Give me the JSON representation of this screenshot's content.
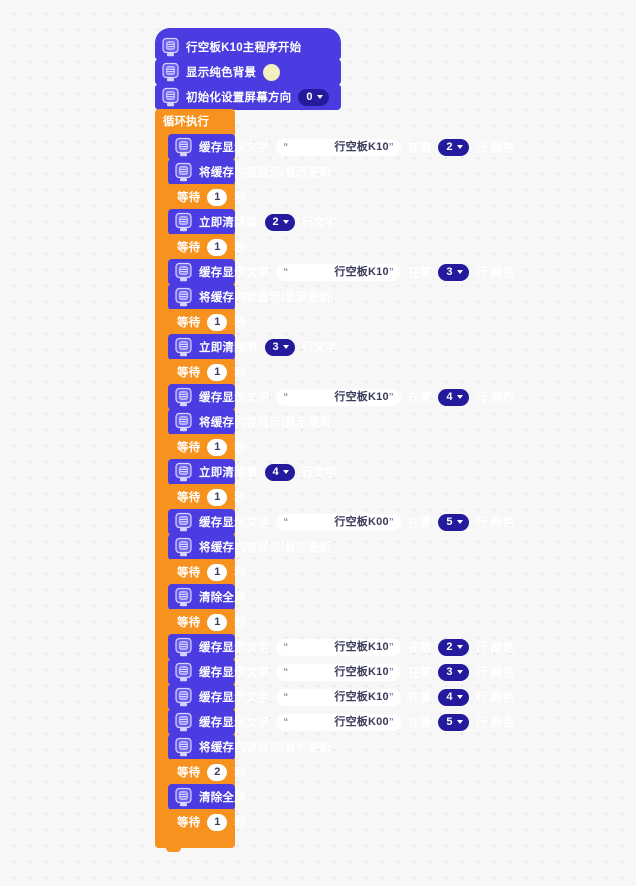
{
  "app": {
    "canvas_background": "#f7f7f7",
    "grid_dot_color": "#e4e4e4",
    "block_colors": {
      "display_purple": "#4a3ce0",
      "control_orange": "#f7921e",
      "dropdown_navy": "#241a9e"
    }
  },
  "icons": {
    "board_icon": "board-k10-icon",
    "dropdown_arrow": "chevron-down-icon"
  },
  "script": {
    "hat": {
      "label": "行空板K10主程序开始"
    },
    "setup": [
      {
        "id": "show-solid-bg",
        "label": "显示纯色背景",
        "swatch": "#f5eec0"
      },
      {
        "id": "init-screen-orientation",
        "label": "初始化设置屏幕方向",
        "dropdown": "0"
      }
    ],
    "loop": {
      "label": "循环执行",
      "blocks": [
        {
          "kind": "cache-text",
          "prefix": "缓存显示文字",
          "text": "行空板K10",
          "mid": "在第",
          "line": "2",
          "suffix": "行 颜色",
          "swatch": "#f01515"
        },
        {
          "kind": "refresh",
          "label": "将缓存内容显示/显示更新"
        },
        {
          "kind": "wait",
          "prefix": "等待",
          "value": "1",
          "suffix": "秒"
        },
        {
          "kind": "clear-line",
          "prefix": "立即清除第",
          "line": "2",
          "suffix": "行文字"
        },
        {
          "kind": "wait",
          "prefix": "等待",
          "value": "1",
          "suffix": "秒"
        },
        {
          "kind": "cache-text",
          "prefix": "缓存显示文字",
          "text": "行空板K10",
          "mid": "在第",
          "line": "3",
          "suffix": "行 颜色",
          "swatch": "#1414f0"
        },
        {
          "kind": "refresh",
          "label": "将缓存内容显示/显示更新"
        },
        {
          "kind": "wait",
          "prefix": "等待",
          "value": "1",
          "suffix": "秒"
        },
        {
          "kind": "clear-line",
          "prefix": "立即清除第",
          "line": "3",
          "suffix": "行文字"
        },
        {
          "kind": "wait",
          "prefix": "等待",
          "value": "1",
          "suffix": "秒"
        },
        {
          "kind": "cache-text",
          "prefix": "缓存显示文字",
          "text": "行空板K10",
          "mid": "在第",
          "line": "4",
          "suffix": "行 颜色",
          "swatch": "#17d81d"
        },
        {
          "kind": "refresh",
          "label": "将缓存内容显示/显示更新"
        },
        {
          "kind": "wait",
          "prefix": "等待",
          "value": "1",
          "suffix": "秒"
        },
        {
          "kind": "clear-line",
          "prefix": "立即清除第",
          "line": "4",
          "suffix": "行文字"
        },
        {
          "kind": "wait",
          "prefix": "等待",
          "value": "1",
          "suffix": "秒"
        },
        {
          "kind": "cache-text",
          "prefix": "缓存显示文字",
          "text": "行空板K00",
          "mid": "在第",
          "line": "5",
          "suffix": "行 颜色",
          "swatch": "#333333"
        },
        {
          "kind": "refresh",
          "label": "将缓存内容显示/显示更新"
        },
        {
          "kind": "wait",
          "prefix": "等待",
          "value": "1",
          "suffix": "秒"
        },
        {
          "kind": "clear-all",
          "label": "清除全屏"
        },
        {
          "kind": "wait",
          "prefix": "等待",
          "value": "1",
          "suffix": "秒"
        },
        {
          "kind": "cache-text",
          "prefix": "缓存显示文字",
          "text": "行空板K10",
          "mid": "在第",
          "line": "2",
          "suffix": "行 颜色",
          "swatch": "#f01515"
        },
        {
          "kind": "cache-text",
          "prefix": "缓存显示文字",
          "text": "行空板K10",
          "mid": "在第",
          "line": "3",
          "suffix": "行 颜色",
          "swatch": "#1414f0"
        },
        {
          "kind": "cache-text",
          "prefix": "缓存显示文字",
          "text": "行空板K10",
          "mid": "在第",
          "line": "4",
          "suffix": "行 颜色",
          "swatch": "#17d81d"
        },
        {
          "kind": "cache-text",
          "prefix": "缓存显示文字",
          "text": "行空板K00",
          "mid": "在第",
          "line": "5",
          "suffix": "行 颜色",
          "swatch": "#333333"
        },
        {
          "kind": "refresh",
          "label": "将缓存内容显示/显示更新"
        },
        {
          "kind": "wait",
          "prefix": "等待",
          "value": "2",
          "suffix": "秒"
        },
        {
          "kind": "clear-all",
          "label": "清除全屏"
        },
        {
          "kind": "wait",
          "prefix": "等待",
          "value": "1",
          "suffix": "秒"
        }
      ]
    }
  }
}
